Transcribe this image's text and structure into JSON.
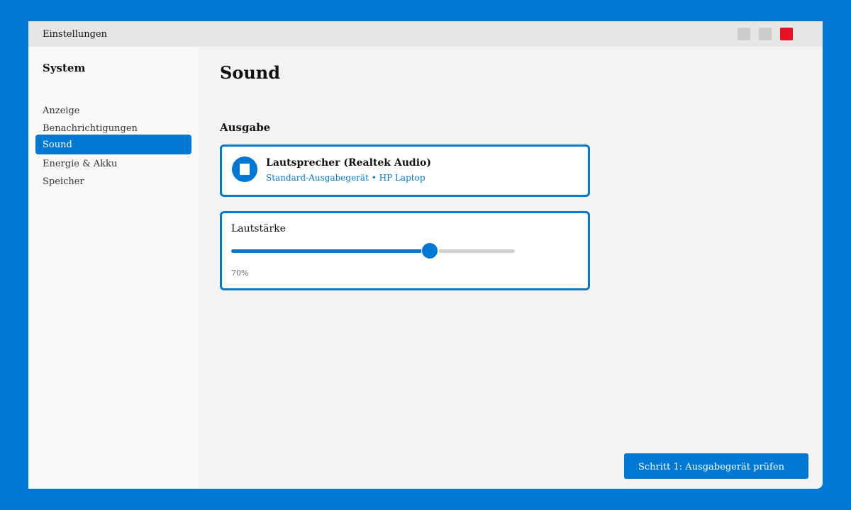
{
  "window": {
    "title": "Einstellungen"
  },
  "sidebar": {
    "heading": "System",
    "items": [
      {
        "label": "Anzeige",
        "active": false
      },
      {
        "label": "Benachrichtigungen",
        "active": false
      },
      {
        "label": "Sound",
        "active": true
      },
      {
        "label": "Energie & Akku",
        "active": false
      },
      {
        "label": "Speicher",
        "active": false
      }
    ]
  },
  "main": {
    "title": "Sound",
    "output_section": "Ausgabe",
    "device": {
      "icon": "speaker-icon",
      "name": "Lautsprecher (Realtek Audio)",
      "subtitle": "Standard-Ausgabegerät • HP Laptop"
    },
    "volume": {
      "label": "Lautstärke",
      "value_percent": 70,
      "value_text": "70%"
    }
  },
  "footer": {
    "step_label": "Schritt 1: Ausgabegerät prüfen"
  },
  "colors": {
    "accent": "#0078d4",
    "close": "#e81123"
  }
}
